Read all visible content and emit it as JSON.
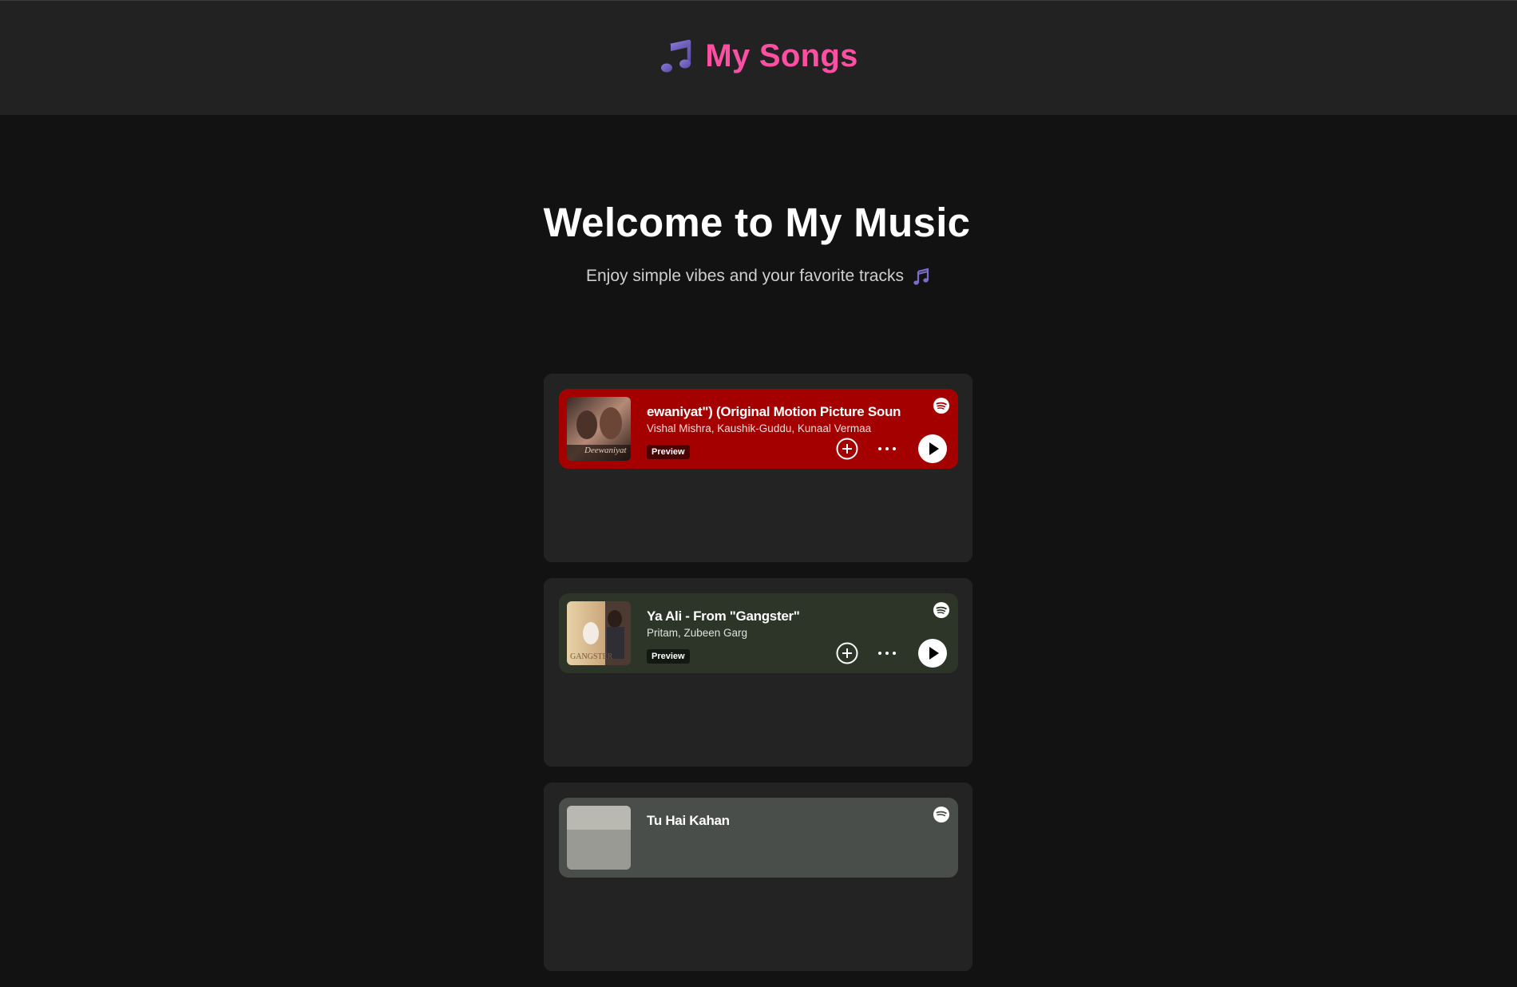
{
  "header": {
    "title": "My Songs",
    "icon": "music-note-icon",
    "title_color": "#ff4fa3"
  },
  "hero": {
    "heading": "Welcome to My Music",
    "subtitle": "Enjoy simple vibes and your favorite tracks",
    "subtitle_icon": "music-notes-icon"
  },
  "tracks": [
    {
      "title": "ewaniyat\") (Original Motion Picture Soun",
      "artists": "Vishal Mishra, Kaushik-Guddu, Kunaal Vermaa",
      "badge": "Preview",
      "color": "#a50000"
    },
    {
      "title": "Ya Ali - From \"Gangster\"",
      "artists": "Pritam, Zubeen Garg",
      "badge": "Preview",
      "color": "#2c3528"
    },
    {
      "title": "Tu Hai Kahan",
      "color": "#4a4e4a"
    }
  ]
}
